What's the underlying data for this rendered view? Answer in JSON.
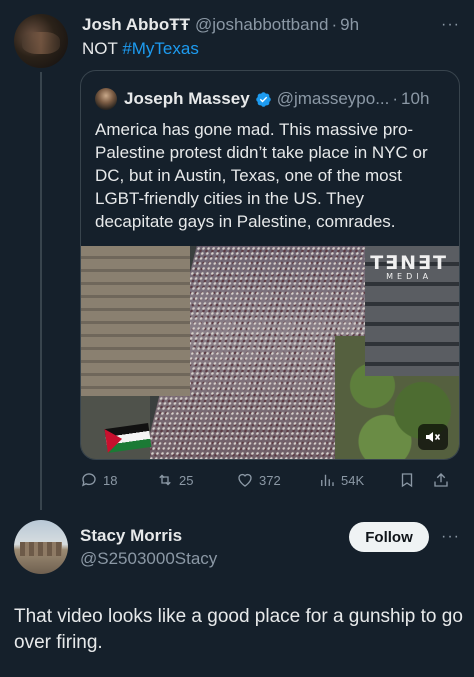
{
  "main_tweet": {
    "display_name": "Josh AbboŦŦ",
    "handle": "@joshabbottband",
    "separator": "·",
    "time": "9h",
    "text_prefix": "NOT",
    "hashtag": "#MyTexas",
    "more": "···"
  },
  "quoted_tweet": {
    "display_name": "Joseph Massey",
    "handle": "@jmasseypo...",
    "separator": "·",
    "time": "10h",
    "verified": true,
    "text": "America has gone mad. This massive pro-Palestine protest didn’t take place in NYC or DC, but in Austin, Texas, one of the most LGBT-friendly cities in the US. They decapitate gays in Palestine, comrades.",
    "media": {
      "watermark_main": "T∃N∃T",
      "watermark_sub": "MEDIA",
      "muted": true
    }
  },
  "actions": {
    "replies": "18",
    "reposts": "25",
    "likes": "372",
    "views": "54K"
  },
  "reply": {
    "display_name": "Stacy Morris",
    "handle": "@S2503000Stacy",
    "follow_label": "Follow",
    "more": "···",
    "text": "That video looks like a good place for a gunship to go over firing."
  },
  "colors": {
    "background": "#15202b",
    "text": "#e7e9ea",
    "secondary": "#8b98a5",
    "accent": "#1d9bf0",
    "border": "#38444d"
  }
}
